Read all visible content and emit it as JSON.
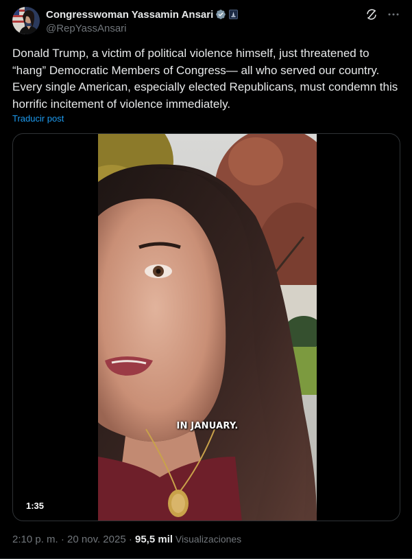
{
  "author": {
    "display_name": "Congresswoman Yassamin Ansari",
    "handle": "@RepYassAnsari",
    "verified_icon": "verified-badge-icon",
    "affiliation_icon": "government-badge-icon"
  },
  "tweet": {
    "text": "Donald Trump, a victim of political violence himself, just threatened to “hang” Democratic Members of Congress— all who served our country. Every single American, especially elected Republicans, must condemn this horrific incitement of violence immediately.",
    "translate_label": "Traducir post"
  },
  "video": {
    "caption": "IN JANUARY.",
    "duration": "1:35"
  },
  "meta": {
    "timestamp": "2:10 p. m. · 20 nov. 2025 · ",
    "views_count": "95,5 mil",
    "views_label": " Visualizaciones"
  },
  "colors": {
    "background": "#000000",
    "text": "#e7e9ea",
    "muted": "#71767b",
    "link": "#1d9bf0",
    "verified": "#829aab"
  }
}
